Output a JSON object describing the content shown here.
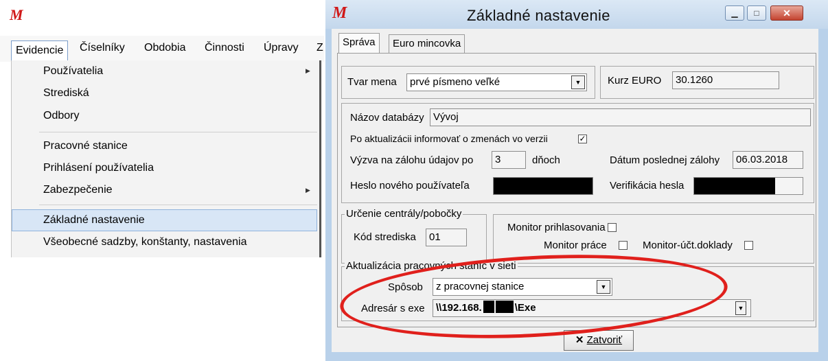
{
  "left": {
    "menubar": [
      "Evidencie",
      "Číselníky",
      "Obdobia",
      "Činnosti",
      "Úpravy",
      "Z"
    ],
    "dropdown": {
      "items": [
        {
          "label": "Používatelia",
          "submenu": true
        },
        {
          "label": "Strediská"
        },
        {
          "label": "Odbory"
        },
        {
          "label": "Pracovné stanice"
        },
        {
          "label": "Prihlásení používatelia"
        },
        {
          "label": "Zabezpečenie",
          "submenu": true
        },
        {
          "label": "Základné nastavenie",
          "highlighted": true
        },
        {
          "label": "Všeobecné sadzby, konštanty, nastavenia"
        }
      ]
    }
  },
  "window": {
    "title": "Základné nastavenie",
    "tabs": [
      "Správa",
      "Euro mincovka"
    ],
    "active_tab": "Správa",
    "tvar_mena": {
      "label": "Tvar mena",
      "value": "prvé písmeno veľké"
    },
    "kurz_euro": {
      "label": "Kurz EURO",
      "value": "30.1260"
    },
    "nazov_databazy": {
      "label": "Názov databázy",
      "value": "Vývoj"
    },
    "po_aktualizacii": {
      "label": "Po aktualizácii informovať o zmenách vo verzii",
      "checked": true
    },
    "vyzva": {
      "label": "Výzva na zálohu údajov po",
      "value": "3",
      "unit": "dňoch"
    },
    "datum_zalohy": {
      "label": "Dátum poslednej zálohy",
      "value": "06.03.2018"
    },
    "heslo": {
      "label": "Heslo nového používateľa"
    },
    "verifikacia": {
      "label": "Verifikácia hesla"
    },
    "urcenie": {
      "title": "Určenie centrály/pobočky",
      "kod_label": "Kód strediska",
      "kod_value": "01"
    },
    "monitor_prihlasovania": {
      "label": "Monitor prihlasovania",
      "checked": false
    },
    "monitor_prace": {
      "label": "Monitor práce",
      "checked": false
    },
    "monitor_uct": {
      "label": "Monitor-účt.doklady",
      "checked": false
    },
    "aktualizacia": {
      "title": "Aktualizácia pracovných staníc v sieti",
      "sposob_label": "Spôsob",
      "sposob_value": "z pracovnej stanice",
      "adresar_label": "Adresár s exe",
      "adresar_prefix": "\\\\192.168.",
      "adresar_suffix": "\\Exe"
    },
    "close_button": "Zatvoriť",
    "highlight_color": "#e0201c"
  }
}
